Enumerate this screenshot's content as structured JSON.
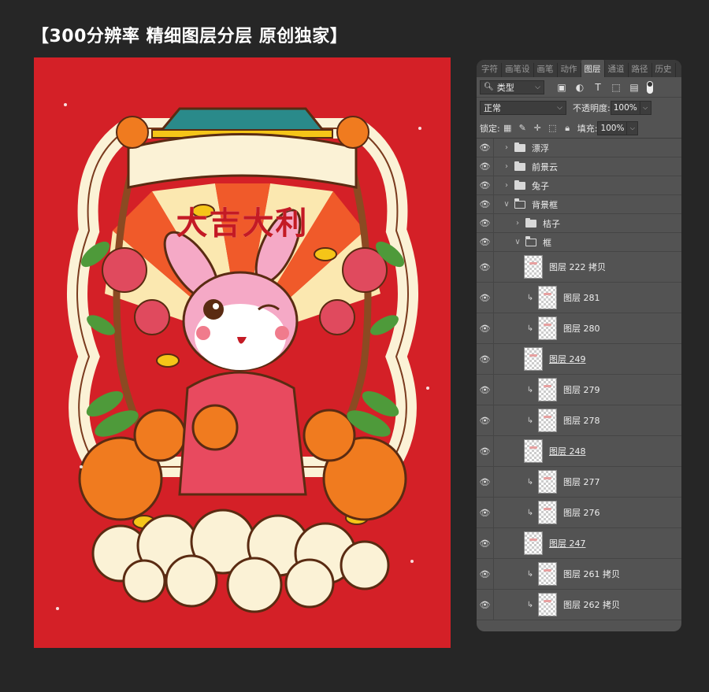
{
  "headline": "【300分辨率 精细图层分层 原创独家】",
  "poster": {
    "title": "大吉大利",
    "colors": {
      "background": "#d42027",
      "cream": "#fbf2d6",
      "orange": "#f07b1f",
      "pink": "#f5a9c6",
      "green": "#4e9a3a",
      "gold": "#f5c518"
    }
  },
  "ps": {
    "tabs": [
      "字符",
      "画笔设",
      "画笔",
      "动作",
      "图层",
      "通道",
      "路径",
      "历史"
    ],
    "active_tab": "图层",
    "filter": {
      "kind_label": "类型",
      "icons": [
        "image-filter-icon",
        "adjust-filter-icon",
        "text-filter-icon",
        "shape-filter-icon",
        "smart-filter-icon"
      ]
    },
    "blend_mode": "正常",
    "opacity_label": "不透明度:",
    "opacity_value": "100%",
    "lock_label": "锁定:",
    "fill_label": "填充:",
    "fill_value": "100%",
    "layers": [
      {
        "type": "group",
        "indent": 0,
        "open": false,
        "name": "漂浮"
      },
      {
        "type": "group",
        "indent": 0,
        "open": false,
        "name": "前景云"
      },
      {
        "type": "group",
        "indent": 0,
        "open": false,
        "name": "兔子"
      },
      {
        "type": "group",
        "indent": 0,
        "open": true,
        "name": "背景框"
      },
      {
        "type": "group",
        "indent": 1,
        "open": false,
        "name": "桔子"
      },
      {
        "type": "group",
        "indent": 1,
        "open": true,
        "name": "框"
      },
      {
        "type": "layer",
        "clip": false,
        "name": "图层 222 拷贝",
        "strike": false
      },
      {
        "type": "layer",
        "clip": true,
        "name": "图层 281",
        "strike": false
      },
      {
        "type": "layer",
        "clip": true,
        "name": "图层 280",
        "strike": false
      },
      {
        "type": "layer",
        "clip": false,
        "name": "图层 249",
        "strike": true
      },
      {
        "type": "layer",
        "clip": true,
        "name": "图层 279",
        "strike": false
      },
      {
        "type": "layer",
        "clip": true,
        "name": "图层 278",
        "strike": false
      },
      {
        "type": "layer",
        "clip": false,
        "name": "图层 248",
        "strike": true
      },
      {
        "type": "layer",
        "clip": true,
        "name": "图层 277",
        "strike": false
      },
      {
        "type": "layer",
        "clip": true,
        "name": "图层 276",
        "strike": false
      },
      {
        "type": "layer",
        "clip": false,
        "name": "图层 247",
        "strike": true
      },
      {
        "type": "layer",
        "clip": true,
        "name": "图层 261 拷贝",
        "strike": false
      },
      {
        "type": "layer",
        "clip": true,
        "name": "图层 262 拷贝",
        "strike": false
      }
    ]
  }
}
